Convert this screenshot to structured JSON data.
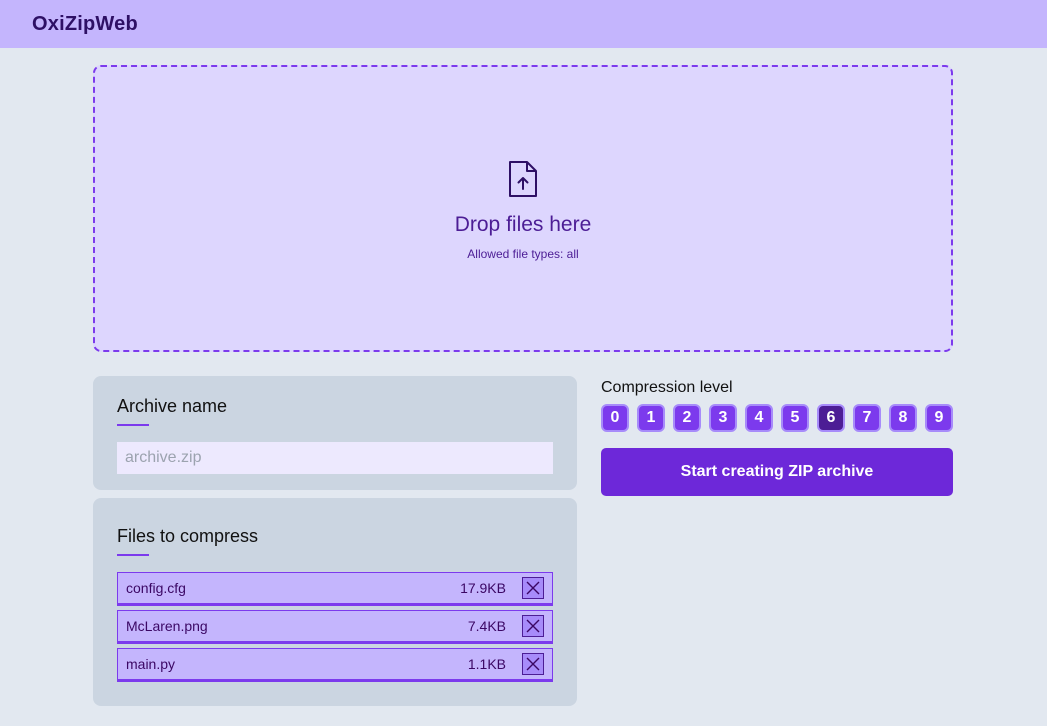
{
  "app": {
    "title": "OxiZipWeb"
  },
  "dropzone": {
    "icon": "file-upload-icon",
    "title": "Drop files here",
    "subtitle": "Allowed file types: all"
  },
  "archive": {
    "title": "Archive name",
    "placeholder": "archive.zip",
    "value": ""
  },
  "files": {
    "title": "Files to compress",
    "items": [
      {
        "name": "config.cfg",
        "size": "17.9KB"
      },
      {
        "name": "McLaren.png",
        "size": "7.4KB"
      },
      {
        "name": "main.py",
        "size": "1.1KB"
      }
    ],
    "remove_icon": "close-icon"
  },
  "compression": {
    "label": "Compression level",
    "levels": [
      "0",
      "1",
      "2",
      "3",
      "4",
      "5",
      "6",
      "7",
      "8",
      "9"
    ],
    "selected": "6"
  },
  "actions": {
    "start_label": "Start creating ZIP archive"
  },
  "colors": {
    "accent": "#6d28d9",
    "header_bg": "#c4b5fd",
    "dropzone_bg": "#ddd6fe",
    "panel_bg": "#cbd5e1",
    "page_bg": "#e2e8f0"
  }
}
